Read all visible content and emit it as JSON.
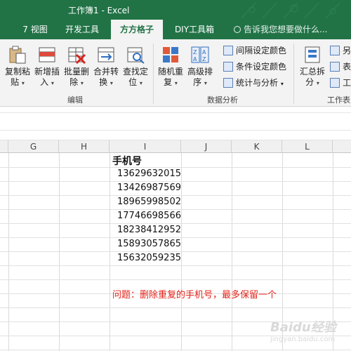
{
  "window": {
    "title": "工作簿1 - Excel"
  },
  "tabs": [
    {
      "label": "7 视图"
    },
    {
      "label": "开发工具"
    },
    {
      "label": "方方格子"
    },
    {
      "label": "DIY工具箱"
    }
  ],
  "tellme": {
    "text": "告诉我您想要做什么..."
  },
  "ribbon": {
    "edit_group": {
      "label": "编辑",
      "buttons": [
        {
          "label1": "复制粘",
          "label2": "贴",
          "icon": "paste-icon"
        },
        {
          "label1": "新增插",
          "label2": "入",
          "icon": "insert-rows-icon"
        },
        {
          "label1": "批量删",
          "label2": "除",
          "icon": "batch-delete-icon"
        },
        {
          "label1": "合并转",
          "label2": "换",
          "icon": "merge-convert-icon"
        },
        {
          "label1": "查找定",
          "label2": "位",
          "icon": "find-locate-icon"
        }
      ]
    },
    "analysis_group": {
      "label": "数据分析",
      "buttons": [
        {
          "label1": "随机重",
          "label2": "复",
          "icon": "random-repeat-icon"
        },
        {
          "label1": "高级排",
          "label2": "序",
          "icon": "advanced-sort-icon"
        }
      ],
      "small_buttons": [
        {
          "label": "间隔设定颜色"
        },
        {
          "label": "条件设定颜色"
        },
        {
          "label": "统计与分析"
        }
      ]
    },
    "workbook_group": {
      "label": "工作表",
      "buttons": [
        {
          "label1": "汇总拆",
          "label2": "分",
          "icon": "summary-split-icon"
        }
      ],
      "small_buttons": [
        {
          "label": "另"
        },
        {
          "label": "表"
        },
        {
          "label": "工"
        }
      ]
    }
  },
  "columns": [
    "G",
    "H",
    "I",
    "J",
    "K",
    "L"
  ],
  "sheet": {
    "header": "手机号",
    "phones": [
      "13629632015",
      "13426987569",
      "18965998502",
      "17746698566",
      "18238412952",
      "15893057865",
      "15632059235"
    ],
    "note": "问题：删除重复的手机号，最多保留一个"
  },
  "watermark": {
    "text": "Baidu经验",
    "sub": "jingyan.baidu.com"
  },
  "colors": {
    "brand": "#217346",
    "note": "#e2231a"
  }
}
